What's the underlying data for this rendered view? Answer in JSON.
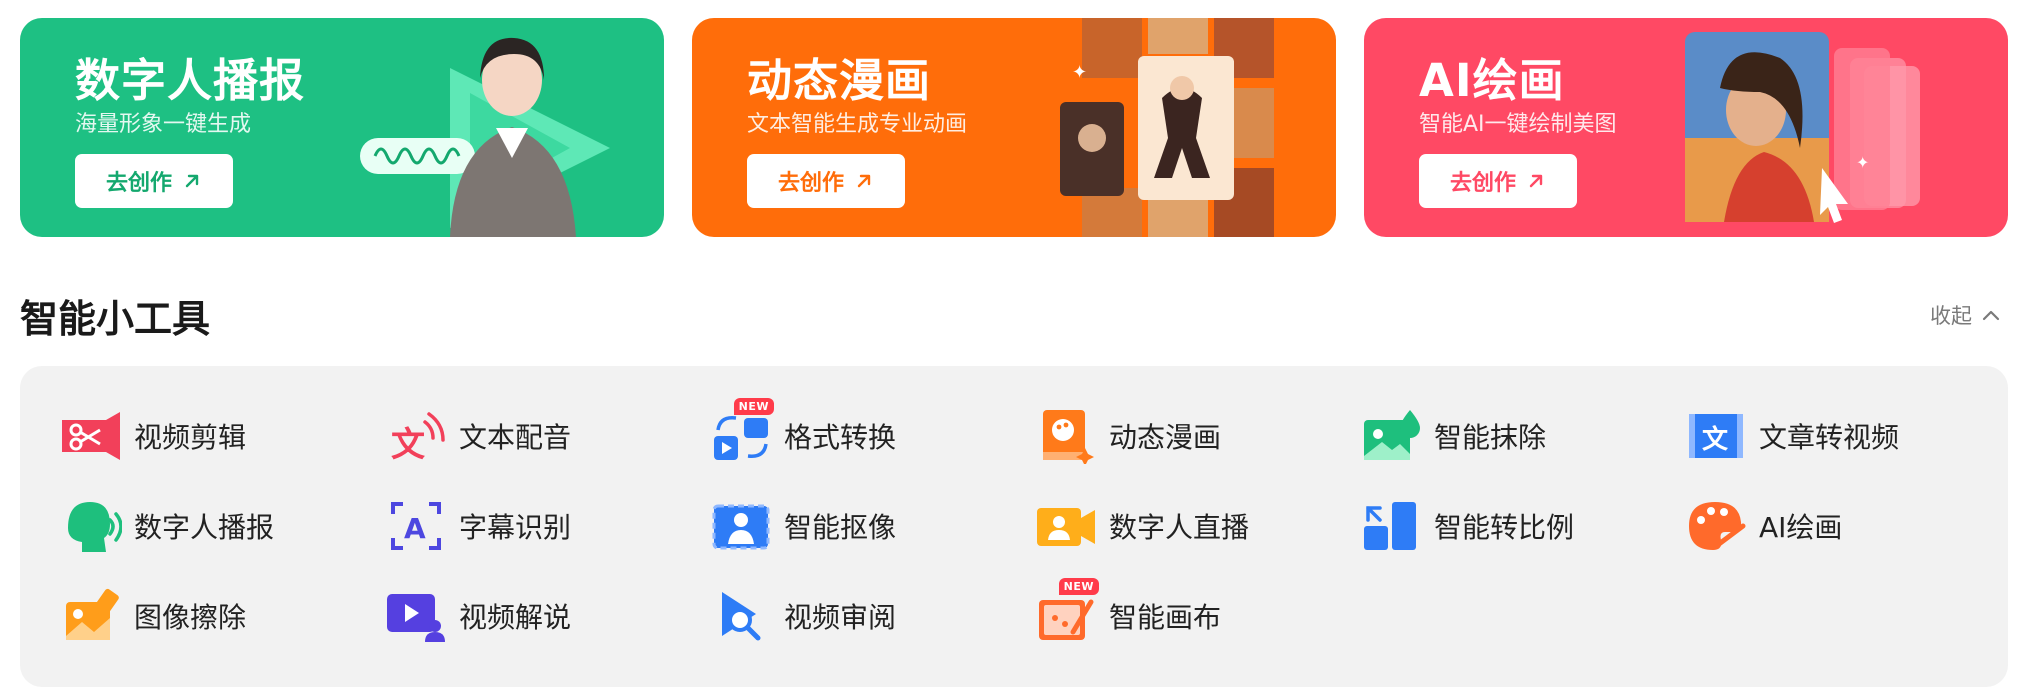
{
  "banners": [
    {
      "title": "数字人播报",
      "subtitle": "海量形象一键生成",
      "button": "去创作",
      "color": "#1ec083"
    },
    {
      "title": "动态漫画",
      "subtitle": "文本智能生成专业动画",
      "button": "去创作",
      "color": "#ff6d0a"
    },
    {
      "title": "AI绘画",
      "subtitle": "智能AI一键绘制美图",
      "button": "去创作",
      "color": "#ff4964"
    }
  ],
  "section": {
    "title": "智能小工具",
    "collapse_label": "收起"
  },
  "tools": [
    {
      "label": "视频剪辑",
      "icon": "video-cut-icon"
    },
    {
      "label": "文本配音",
      "icon": "text-dubbing-icon"
    },
    {
      "label": "格式转换",
      "icon": "format-convert-icon",
      "badge": "NEW"
    },
    {
      "label": "动态漫画",
      "icon": "dynamic-comic-icon"
    },
    {
      "label": "智能抹除",
      "icon": "smart-erase-icon"
    },
    {
      "label": "文章转视频",
      "icon": "article-to-video-icon"
    },
    {
      "label": "数字人播报",
      "icon": "digital-human-icon"
    },
    {
      "label": "字幕识别",
      "icon": "subtitle-recognition-icon"
    },
    {
      "label": "智能抠像",
      "icon": "smart-matting-icon"
    },
    {
      "label": "数字人直播",
      "icon": "digital-human-live-icon"
    },
    {
      "label": "智能转比例",
      "icon": "aspect-ratio-icon"
    },
    {
      "label": "AI绘画",
      "icon": "ai-paint-icon"
    },
    {
      "label": "图像擦除",
      "icon": "image-erase-icon"
    },
    {
      "label": "视频解说",
      "icon": "video-narration-icon"
    },
    {
      "label": "视频审阅",
      "icon": "video-review-icon"
    },
    {
      "label": "智能画布",
      "icon": "smart-canvas-icon",
      "badge": "NEW"
    }
  ]
}
